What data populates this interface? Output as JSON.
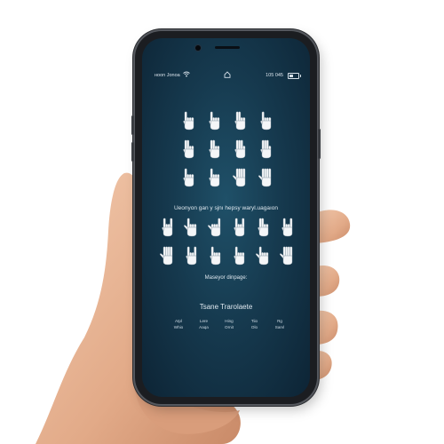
{
  "status_bar": {
    "carrier": "нoon Jonoa",
    "time": "105 045",
    "wifi_icon": "wifi-icon",
    "home_icon": "home-icon",
    "battery_icon": "battery-icon"
  },
  "sign_rows_top": [
    [
      "index-up",
      "index-up",
      "two-fingers",
      "index-up"
    ],
    [
      "two-fingers",
      "two-fingers",
      "three-fingers",
      "three-fingers"
    ],
    [
      "index-up",
      "index-up",
      "open-palm",
      "open-palm"
    ]
  ],
  "caption1": "Ueonyon gan y sjnı hepsy waryl.uagaıon",
  "sign_rows_bottom": [
    [
      "rock-horns",
      "point",
      "pinky-thumb",
      "rock-horns",
      "two-fingers",
      "rock-horns"
    ],
    [
      "open-palm",
      "rock-horns",
      "index-up",
      "index-up",
      "point",
      "open-palm"
    ]
  ],
  "caption2": "Maseyor dinpage:",
  "translate_title": "Tsane Trarolaete",
  "translations": {
    "row1": [
      "Atpl",
      "Lere",
      "Hing",
      "Tiio",
      "Rg"
    ],
    "row2": [
      "Whio",
      "Aaqa",
      "Ornit",
      "Olo",
      "Sarvl"
    ]
  },
  "colors": {
    "screen_center": "#1f5068",
    "screen_edge": "#0d2435",
    "text": "#dfe8ef"
  }
}
